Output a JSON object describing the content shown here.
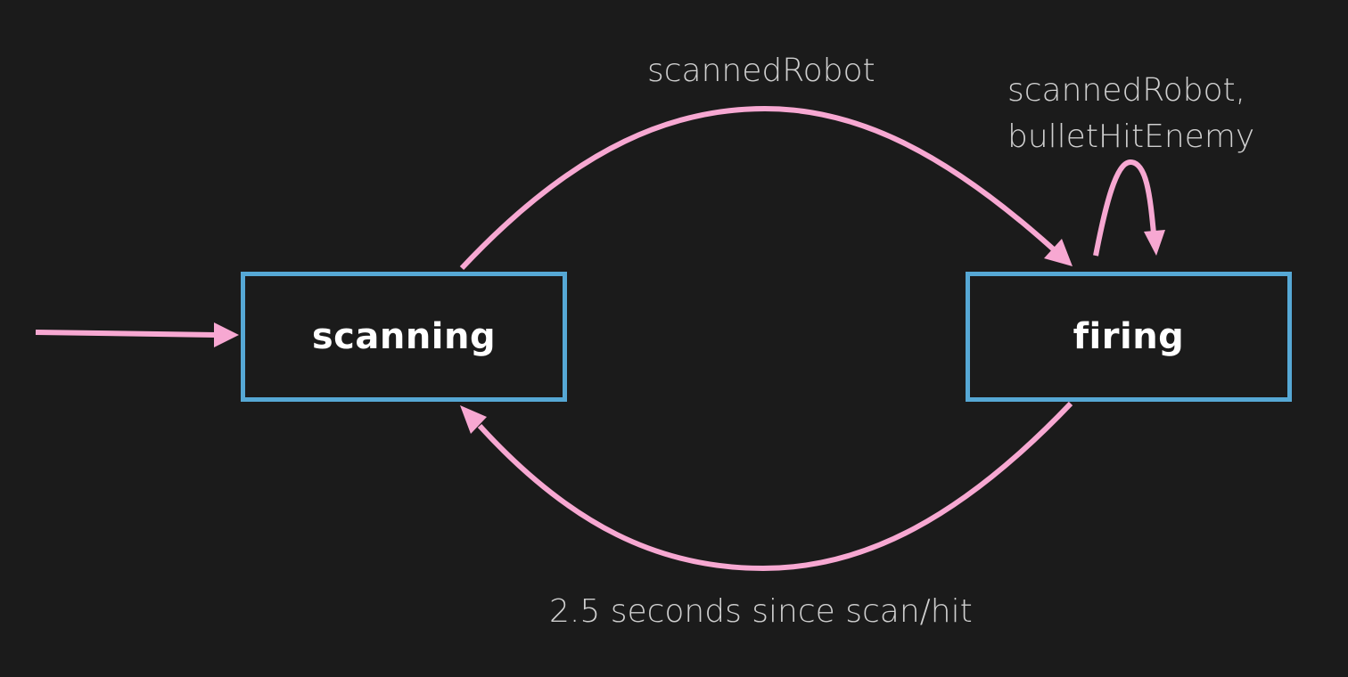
{
  "colors": {
    "background": "#1b1b1b",
    "state_border": "#56a8d5",
    "transition": "#f7a8d2",
    "state_text": "#ffffff",
    "label_text": "#cfcfcf"
  },
  "states": {
    "scanning": {
      "label": "scanning",
      "initial": true
    },
    "firing": {
      "label": "firing",
      "initial": false
    }
  },
  "transitions": {
    "scan_to_fire": {
      "from": "scanning",
      "to": "firing",
      "label": "scannedRobot"
    },
    "fire_self": {
      "from": "firing",
      "to": "firing",
      "label_lines": [
        "scannedRobot,",
        "bulletHitEnemy"
      ]
    },
    "fire_to_scan": {
      "from": "firing",
      "to": "scanning",
      "label": "2.5 seconds since scan/hit"
    }
  }
}
